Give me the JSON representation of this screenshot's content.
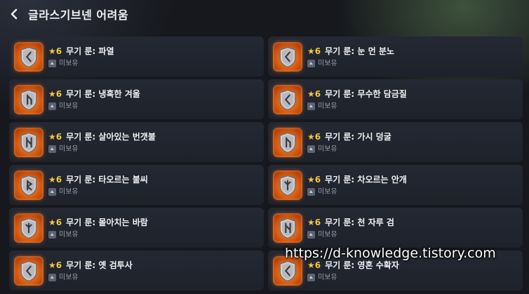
{
  "header": {
    "title": "글라스기브넨 어려움"
  },
  "colors": {
    "star": "#f4c542",
    "icon_glow": "#e0661a",
    "card_bg": "#22262f"
  },
  "items": [
    {
      "star": "★",
      "grade": "6",
      "name": "무기 룬: 파열",
      "status": "미보유",
      "icon": "rune-shield-icon"
    },
    {
      "star": "★",
      "grade": "6",
      "name": "무기 룬: 눈 먼 분노",
      "status": "미보유",
      "icon": "rune-shield-icon"
    },
    {
      "star": "★",
      "grade": "6",
      "name": "무기 룬: 냉혹한 겨울",
      "status": "미보유",
      "icon": "rune-shield-icon"
    },
    {
      "star": "★",
      "grade": "6",
      "name": "무기 룬: 무수한 담금질",
      "status": "미보유",
      "icon": "rune-shield-icon"
    },
    {
      "star": "★",
      "grade": "6",
      "name": "무기 룬: 살아있는 번갯불",
      "status": "미보유",
      "icon": "rune-shield-icon"
    },
    {
      "star": "★",
      "grade": "6",
      "name": "무기 룬: 가시 덩굴",
      "status": "미보유",
      "icon": "rune-shield-icon"
    },
    {
      "star": "★",
      "grade": "6",
      "name": "무기 룬: 타오르는 불씨",
      "status": "미보유",
      "icon": "rune-shield-icon"
    },
    {
      "star": "★",
      "grade": "6",
      "name": "무기 룬: 차오르는 안개",
      "status": "미보유",
      "icon": "rune-shield-icon"
    },
    {
      "star": "★",
      "grade": "6",
      "name": "무기 룬: 몰아치는 바람",
      "status": "미보유",
      "icon": "rune-shield-icon"
    },
    {
      "star": "★",
      "grade": "6",
      "name": "무기 룬: 천 자루 검",
      "status": "미보유",
      "icon": "rune-shield-icon"
    },
    {
      "star": "★",
      "grade": "6",
      "name": "무기 룬: 옛 검투사",
      "status": "미보유",
      "icon": "rune-shield-icon"
    },
    {
      "star": "★",
      "grade": "6",
      "name": "무기 룬: 영혼 수확자",
      "status": "미보유",
      "icon": "rune-shield-icon"
    }
  ],
  "watermark": "https://d-knowledge.tistory.com"
}
